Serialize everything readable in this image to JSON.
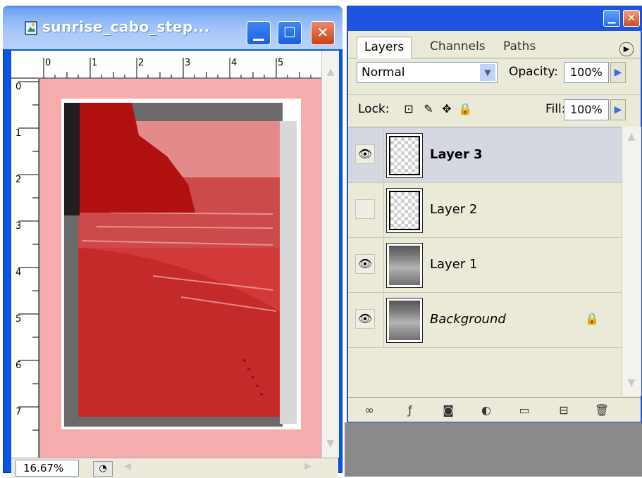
{
  "document": {
    "title": "sunrise_cabo_step...",
    "ruler_h_labels": [
      "0",
      "1",
      "2",
      "3",
      "4",
      "5"
    ],
    "ruler_v_labels": [
      "0",
      "1",
      "2",
      "3",
      "4",
      "5",
      "6",
      "7"
    ],
    "zoom": "16.67%"
  },
  "layers_panel": {
    "tabs": [
      "Layers",
      "Channels",
      "Paths"
    ],
    "active_tab": "Layers",
    "blend_mode": "Normal",
    "opacity_label": "Opacity:",
    "opacity_value": "100%",
    "lock_label": "Lock:",
    "fill_label": "Fill:",
    "fill_value": "100%",
    "layers": [
      {
        "name": "Layer 3",
        "visible": true,
        "selected": true,
        "thumb": "transparent"
      },
      {
        "name": "Layer 2",
        "visible": false,
        "selected": false,
        "thumb": "transparent"
      },
      {
        "name": "Layer 1",
        "visible": true,
        "selected": false,
        "thumb": "photo"
      },
      {
        "name": "Background",
        "visible": true,
        "selected": false,
        "thumb": "photo",
        "locked": true
      }
    ]
  },
  "colors": {
    "title_blue": "#0a54e3",
    "canvas_pink": "#f7adad",
    "overlay_red": "#cc2020",
    "panel_bg": "#ebe9d8"
  }
}
